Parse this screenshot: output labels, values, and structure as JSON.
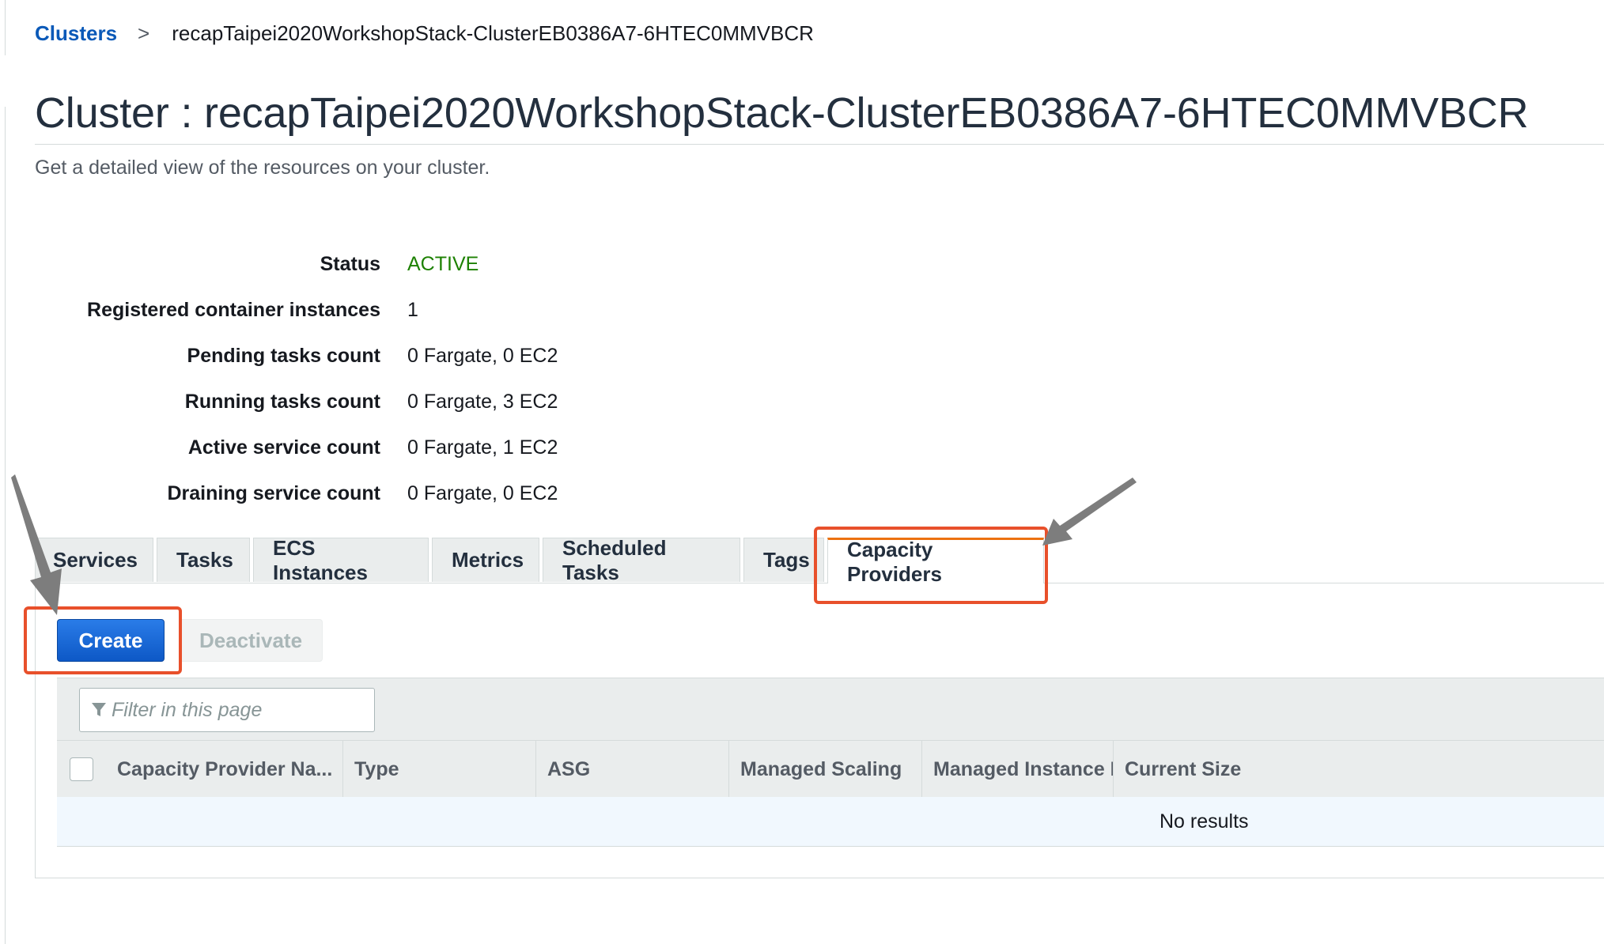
{
  "breadcrumb": {
    "root": "Clusters",
    "separator": ">",
    "current": "recapTaipei2020WorkshopStack-ClusterEB0386A7-6HTEC0MMVBCR"
  },
  "header": {
    "title": "Cluster : recapTaipei2020WorkshopStack-ClusterEB0386A7-6HTEC0MMVBCR",
    "subtitle": "Get a detailed view of the resources on your cluster."
  },
  "details": [
    {
      "label": "Status",
      "value": "ACTIVE"
    },
    {
      "label": "Registered container instances",
      "value": "1"
    },
    {
      "label": "Pending tasks count",
      "value": "0 Fargate, 0 EC2"
    },
    {
      "label": "Running tasks count",
      "value": "0 Fargate, 3 EC2"
    },
    {
      "label": "Active service count",
      "value": "0 Fargate, 1 EC2"
    },
    {
      "label": "Draining service count",
      "value": "0 Fargate, 0 EC2"
    }
  ],
  "tabs": [
    {
      "label": "Services"
    },
    {
      "label": "Tasks"
    },
    {
      "label": "ECS Instances"
    },
    {
      "label": "Metrics"
    },
    {
      "label": "Scheduled Tasks"
    },
    {
      "label": "Tags"
    },
    {
      "label": "Capacity Providers",
      "active": true
    }
  ],
  "toolbar": {
    "create_label": "Create",
    "deactivate_label": "Deactivate"
  },
  "filter": {
    "placeholder": "Filter in this page"
  },
  "table": {
    "columns": [
      "Capacity Provider Na...",
      "Type",
      "ASG",
      "Managed Scaling",
      "Managed Instance P...",
      "Current Size"
    ],
    "empty_text": "No results"
  },
  "colors": {
    "link": "#0a59b8",
    "status_active": "#1d8102",
    "primary_button": "#1166d6",
    "tab_active_accent": "#ec7211",
    "annotation_highlight": "#e8502b",
    "annotation_arrow": "#7d7d7d"
  }
}
